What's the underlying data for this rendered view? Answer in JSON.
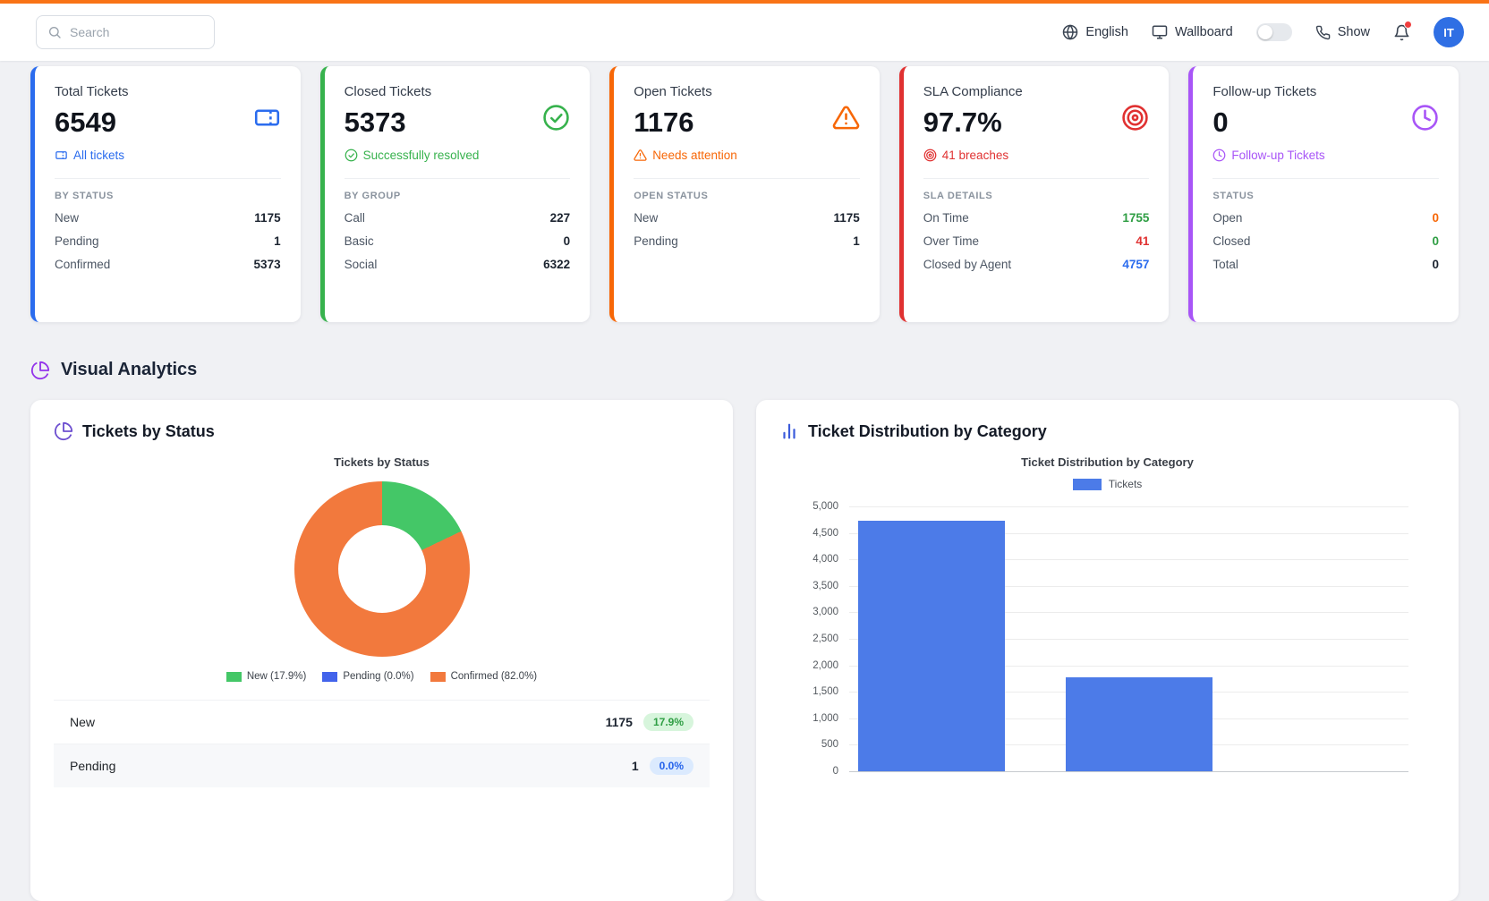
{
  "topbar": {
    "search_placeholder": "Search",
    "language_label": "English",
    "wallboard_label": "Wallboard",
    "show_label": "Show",
    "avatar_initials": "IT"
  },
  "stats_cards": [
    {
      "title": "Total Tickets",
      "value": "6549",
      "badge": "All tickets",
      "accent_color": "#2b6cee",
      "section_label": "BY STATUS",
      "rows": [
        {
          "label": "New",
          "value": "1175"
        },
        {
          "label": "Pending",
          "value": "1"
        },
        {
          "label": "Confirmed",
          "value": "5373"
        }
      ]
    },
    {
      "title": "Closed Tickets",
      "value": "5373",
      "badge": "Successfully resolved",
      "accent_color": "#37b24d",
      "section_label": "BY GROUP",
      "rows": [
        {
          "label": "Call",
          "value": "227"
        },
        {
          "label": "Basic",
          "value": "0"
        },
        {
          "label": "Social",
          "value": "6322"
        }
      ]
    },
    {
      "title": "Open Tickets",
      "value": "1176",
      "badge": "Needs attention",
      "accent_color": "#f76707",
      "section_label": "OPEN STATUS",
      "rows": [
        {
          "label": "New",
          "value": "1175"
        },
        {
          "label": "Pending",
          "value": "1"
        }
      ]
    },
    {
      "title": "SLA Compliance",
      "value": "97.7%",
      "badge": "41 breaches",
      "accent_color": "#e03131",
      "section_label": "SLA DETAILS",
      "rows": [
        {
          "label": "On Time",
          "value": "1755",
          "value_color": "#2f9e44"
        },
        {
          "label": "Over Time",
          "value": "41",
          "value_color": "#e03131"
        },
        {
          "label": "Closed by Agent",
          "value": "4757",
          "value_color": "#2b6cee"
        }
      ]
    },
    {
      "title": "Follow-up Tickets",
      "value": "0",
      "badge": "Follow-up Tickets",
      "accent_color": "#a855f7",
      "section_label": "STATUS",
      "rows": [
        {
          "label": "Open",
          "value": "0",
          "value_color": "#f76707"
        },
        {
          "label": "Closed",
          "value": "0",
          "value_color": "#2f9e44"
        },
        {
          "label": "Total",
          "value": "0"
        }
      ]
    }
  ],
  "section": {
    "title": "Visual Analytics"
  },
  "charts": {
    "status": {
      "card_title": "Tickets by Status",
      "rows": [
        {
          "label": "New",
          "value": "1175",
          "pct": "17.9%",
          "badge_bg": "#d7f5dc",
          "badge_color": "#2f9e44"
        },
        {
          "label": "Pending",
          "value": "1",
          "pct": "0.0%",
          "badge_bg": "#dbeafe",
          "badge_color": "#2563eb"
        }
      ]
    },
    "category": {
      "card_title": "Ticket Distribution by Category"
    }
  },
  "chart_data": [
    {
      "type": "pie",
      "title": "Tickets by Status",
      "labels": [
        "New",
        "Pending",
        "Confirmed"
      ],
      "values": [
        1175,
        1,
        5373
      ],
      "percentages": [
        17.9,
        0.0,
        82.1
      ],
      "colors": [
        "#44c767",
        "#4263eb",
        "#f2793d"
      ],
      "legend": [
        "New (17.9%)",
        "Pending (0.0%)",
        "Confirmed (82.0%)"
      ],
      "legend_position": "bottom",
      "donut": true
    },
    {
      "type": "bar",
      "title": "Ticket Distribution by Category",
      "categories": [
        "",
        ""
      ],
      "series": [
        {
          "name": "Tickets",
          "values": [
            4730,
            1780
          ]
        }
      ],
      "ylim": [
        0,
        5000
      ],
      "yticks": [
        "5,000",
        "4,500",
        "4,000",
        "3,500",
        "3,000",
        "2,500",
        "2,000",
        "1,500",
        "1,000",
        "500",
        "0"
      ],
      "bar_color": "#4c7be8",
      "legend": [
        "Tickets"
      ],
      "legend_position": "top",
      "grid": true
    }
  ]
}
